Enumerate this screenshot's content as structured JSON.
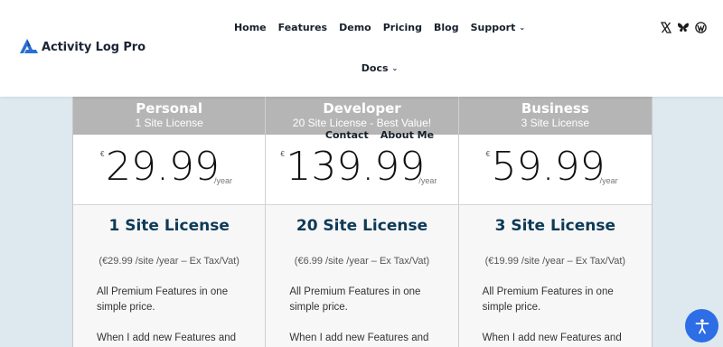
{
  "header": {
    "logo_text": "Activity Log Pro",
    "nav": [
      {
        "label": "Home",
        "has_dropdown": false
      },
      {
        "label": "Features",
        "has_dropdown": false
      },
      {
        "label": "Demo",
        "has_dropdown": false
      },
      {
        "label": "Pricing",
        "has_dropdown": false
      },
      {
        "label": "Blog",
        "has_dropdown": false
      },
      {
        "label": "Support",
        "has_dropdown": true
      },
      {
        "label": "Docs",
        "has_dropdown": true
      },
      {
        "label": "Contact",
        "has_dropdown": false
      },
      {
        "label": "About Me",
        "has_dropdown": false
      }
    ],
    "social_icons": [
      "x-icon",
      "butterfly-icon",
      "wordpress-icon"
    ],
    "dropdown_caret": "⌄"
  },
  "plans": [
    {
      "name": "Personal",
      "subtitle": "1 Site License",
      "currency": "€",
      "price": "29.99",
      "period": "/year",
      "feature_title": "1 Site License",
      "note": "(€29.99 /site /year – Ex Tax/Vat)",
      "text1": "All Premium Features in one simple price.",
      "text2": "When I add new Features and"
    },
    {
      "name": "Developer",
      "subtitle": "20 Site License - Best Value!",
      "currency": "€",
      "price": "139.99",
      "period": "/year",
      "feature_title": "20 Site License",
      "note": "(€6.99 /site /year – Ex Tax/Vat)",
      "text1": "All Premium Features in one simple price.",
      "text2": "When I add new Features and"
    },
    {
      "name": "Business",
      "subtitle": "3 Site License",
      "currency": "€",
      "price": "59.99",
      "period": "/year",
      "feature_title": "3 Site License",
      "note": "(€19.99 /site /year – Ex Tax/Vat)",
      "text1": "All Premium Features in one simple price.",
      "text2": "When I add new Features and"
    }
  ],
  "colors": {
    "header_bg": "#ffffff",
    "page_bg": "#dde8ef",
    "plan_header_bg": "#b5b5b5",
    "feature_title": "#0d3a57",
    "accent_blue": "#2d6ee6"
  },
  "accessibility_button_icon": "accessibility-icon"
}
